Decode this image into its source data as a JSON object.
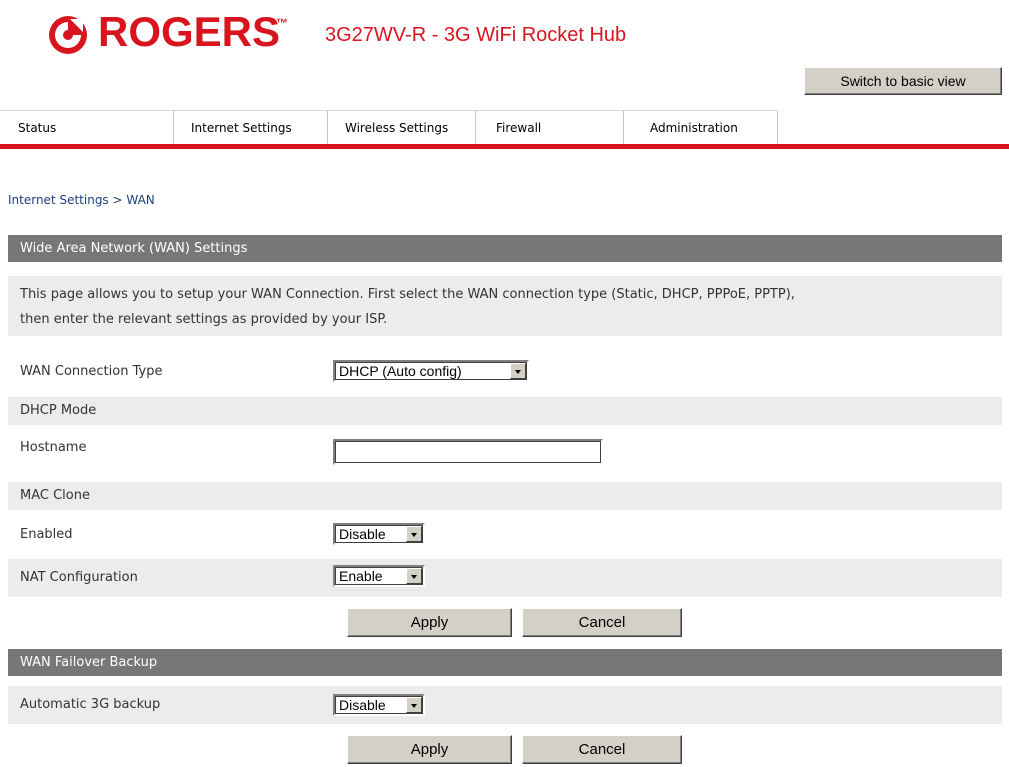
{
  "header": {
    "brand": "ROGERS",
    "trademark": "™",
    "product": "3G27WV-R - 3G WiFi Rocket Hub",
    "switch_label": "Switch to basic view",
    "brand_color": "#d8151f"
  },
  "tabs": [
    {
      "label": "Status"
    },
    {
      "label": "Internet Settings"
    },
    {
      "label": "Wireless Settings"
    },
    {
      "label": "Firewall"
    },
    {
      "label": "Administration"
    }
  ],
  "breadcrumb": "Internet Settings > WAN",
  "wan": {
    "title": "Wide Area Network (WAN) Settings",
    "description_line1": "This page allows you to setup your WAN Connection. First select the WAN connection type (Static, DHCP, PPPoE, PPTP),",
    "description_line2": "then enter the relevant settings as provided by your ISP.",
    "connection_type_label": "WAN Connection Type",
    "connection_type_value": "DHCP (Auto config)",
    "dhcp_mode_label": "DHCP Mode",
    "hostname_label": "Hostname",
    "hostname_value": "",
    "mac_clone_label": "MAC Clone",
    "enabled_label": "Enabled",
    "enabled_value": "Disable",
    "nat_label": "NAT Configuration",
    "nat_value": "Enable",
    "apply_label": "Apply",
    "cancel_label": "Cancel"
  },
  "failover": {
    "title": "WAN Failover Backup",
    "backup_label": "Automatic 3G backup",
    "backup_value": "Disable",
    "apply_label": "Apply",
    "cancel_label": "Cancel"
  }
}
